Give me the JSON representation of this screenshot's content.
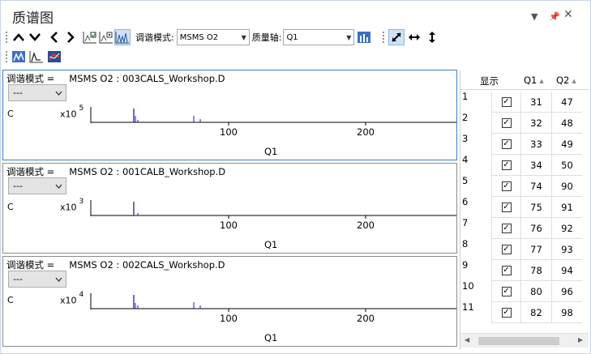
{
  "window": {
    "title": "质谱图"
  },
  "toolbar": {
    "tune_label": "调谐模式:",
    "tune_value": "MSMS O2",
    "mass_axis_label": "质量轴:",
    "mass_axis_value": "Q1"
  },
  "panes": [
    {
      "header_label": "调谐模式 =",
      "header_value": "MSMS O2 : 003CALS_Workshop.D",
      "selector": "---",
      "y_label": "C",
      "scale_base": "x10",
      "scale_exp": "5",
      "x_label": "Q1",
      "ticks": [
        "100",
        "200"
      ],
      "active": true
    },
    {
      "header_label": "调谐模式 =",
      "header_value": "MSMS O2 : 001CALB_Workshop.D",
      "selector": "---",
      "y_label": "C",
      "scale_base": "x10",
      "scale_exp": "3",
      "x_label": "Q1",
      "ticks": [
        "100",
        "200"
      ],
      "active": false
    },
    {
      "header_label": "调谐模式 =",
      "header_value": "MSMS O2 : 002CALS_Workshop.D",
      "selector": "---",
      "y_label": "C",
      "scale_base": "x10",
      "scale_exp": "4",
      "x_label": "Q1",
      "ticks": [
        "100",
        "200"
      ],
      "active": false
    }
  ],
  "grid": {
    "headers": {
      "show": "显示",
      "q1": "Q1",
      "q2": "Q2"
    },
    "rows": [
      {
        "n": "1",
        "q1": "31",
        "q2": "47"
      },
      {
        "n": "2",
        "q1": "32",
        "q2": "48"
      },
      {
        "n": "3",
        "q1": "33",
        "q2": "49"
      },
      {
        "n": "4",
        "q1": "34",
        "q2": "50"
      },
      {
        "n": "5",
        "q1": "74",
        "q2": "90"
      },
      {
        "n": "6",
        "q1": "75",
        "q2": "91"
      },
      {
        "n": "7",
        "q1": "76",
        "q2": "92"
      },
      {
        "n": "8",
        "q1": "77",
        "q2": "93"
      },
      {
        "n": "9",
        "q1": "78",
        "q2": "94"
      },
      {
        "n": "10",
        "q1": "80",
        "q2": "96"
      },
      {
        "n": "11",
        "q1": "82",
        "q2": "98"
      }
    ]
  },
  "colors": {
    "accent": "#3c7fc1",
    "peak": "#1a1acc"
  }
}
